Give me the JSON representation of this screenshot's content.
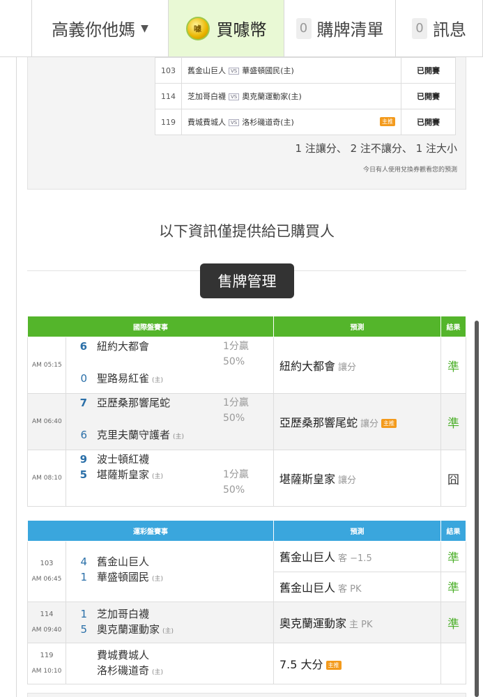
{
  "nav": {
    "user_name": "高義你他媽",
    "buy_label": "買噱幣",
    "coin_text": "噱",
    "list_count": "0",
    "list_label": "購牌清單",
    "msg_count": "0",
    "msg_label": "訊息"
  },
  "summary": {
    "rows": [
      {
        "no": "103",
        "away": "舊金山巨人",
        "vs": "VS",
        "home": "華盛頓國民(主)",
        "badge": "",
        "status": "已開賽"
      },
      {
        "no": "114",
        "away": "芝加哥白襪",
        "vs": "VS",
        "home": "奧克蘭運動家(主)",
        "badge": "",
        "status": "已開賽"
      },
      {
        "no": "119",
        "away": "費城費城人",
        "vs": "VS",
        "home": "洛杉磯道奇(主)",
        "badge": "主推",
        "status": "已開賽"
      }
    ],
    "note": "1 注讓分、 2 注不讓分、 1 注大小",
    "sub": "今日有人使用兌換券觀看您的預測"
  },
  "buyers_only": "以下資訊僅提供給已購買人",
  "sell_button": "售牌管理",
  "intl": {
    "headers": {
      "event": "國際盤賽事",
      "pred": "預測",
      "result": "結果"
    },
    "rows": [
      {
        "time": "AM 05:15",
        "s1": "6",
        "t1": "紐約大都會",
        "s2": "0",
        "t2": "聖路易紅雀",
        "home": "主",
        "odds1": "1分贏",
        "odds2": "50%",
        "pick": "紐約大都會",
        "pick_sub": "讓分",
        "badge": "",
        "result": "準"
      },
      {
        "time": "AM 06:40",
        "s1": "7",
        "t1": "亞歷桑那響尾蛇",
        "s2": "6",
        "t2": "克里夫蘭守護者",
        "home": "主",
        "odds1": "1分贏",
        "odds2": "50%",
        "pick": "亞歷桑那響尾蛇",
        "pick_sub": "讓分",
        "badge": "主推",
        "result": "準"
      },
      {
        "time": "AM 08:10",
        "s1": "9",
        "t1": "波士頓紅襪",
        "s2": "5",
        "t2": "堪薩斯皇家",
        "home": "主",
        "odds1": "1分贏",
        "odds2": "50%",
        "pick": "堪薩斯皇家",
        "pick_sub": "讓分",
        "badge": "",
        "result": "囧"
      }
    ]
  },
  "sport": {
    "headers": {
      "event": "運彩盤賽事",
      "pred": "預測",
      "result": "結果"
    },
    "rows": [
      {
        "no": "103",
        "time": "AM 06:45",
        "s1": "4",
        "t1": "舊金山巨人",
        "s2": "1",
        "t2": "華盛頓國民",
        "home": "主",
        "preds": [
          {
            "pick": "舊金山巨人",
            "sub": "客 −1.5",
            "result": "準"
          },
          {
            "pick": "舊金山巨人",
            "sub": "客 PK",
            "result": "準"
          }
        ]
      },
      {
        "no": "114",
        "time": "AM 09:40",
        "s1": "1",
        "t1": "芝加哥白襪",
        "s2": "5",
        "t2": "奧克蘭運動家",
        "home": "主",
        "preds": [
          {
            "pick": "奧克蘭運動家",
            "sub": "主 PK",
            "result": "準"
          }
        ]
      },
      {
        "no": "119",
        "time": "AM 10:10",
        "s1": "",
        "t1": "費城費城人",
        "s2": "",
        "t2": "洛杉磯道奇",
        "home": "主",
        "preds": [
          {
            "pick": "7.5 大分",
            "sub": "",
            "badge": "主推",
            "result": ""
          }
        ]
      }
    ]
  }
}
